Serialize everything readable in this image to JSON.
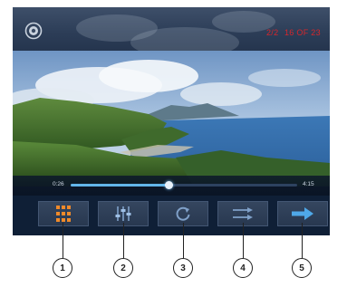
{
  "viewer": {
    "page_indicator": "2/2",
    "photo_count": "16 OF 23",
    "gear_icon": "gear-icon",
    "photo_scene": "coastal landscape with green hills, blue sea and cloudy sky"
  },
  "progress": {
    "current_time": "0:26",
    "total_time": "4:15",
    "played_fraction": 0.43
  },
  "controls": {
    "buttons": [
      {
        "icon": "grid-icon",
        "color": "#f08a2a"
      },
      {
        "icon": "settings-icon",
        "color": "#7fa0c8"
      },
      {
        "icon": "repeat-icon",
        "color": "#7fa0c8"
      },
      {
        "icon": "shuffle-icon",
        "color": "#7fa0c8"
      },
      {
        "icon": "next-arrow-icon",
        "color": "#4fa8e8"
      }
    ]
  },
  "callouts": [
    "1",
    "2",
    "3",
    "4",
    "5"
  ],
  "colors": {
    "indicator_text": "#d7262b",
    "progress_fill": "#63b6ea",
    "grid_icon": "#f08a2a"
  }
}
